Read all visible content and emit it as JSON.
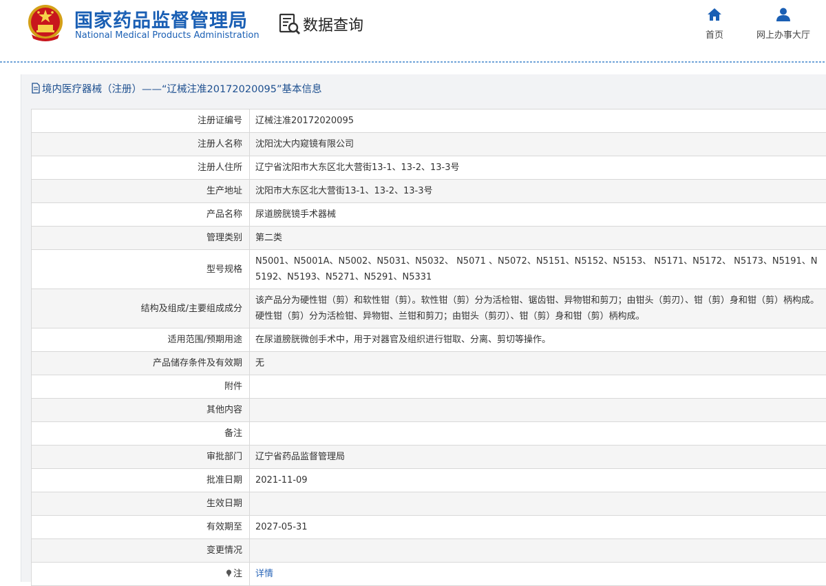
{
  "header": {
    "org_name_cn": "国家药品监督管理局",
    "org_name_en": "National Medical Products Administration",
    "query_label": "数据查询",
    "nav": [
      {
        "label": "首页",
        "icon": "home-icon"
      },
      {
        "label": "网上办事大厅",
        "icon": "user-icon"
      }
    ]
  },
  "colors": {
    "brand_blue": "#1a5fb4",
    "link_blue": "#2a66b8",
    "title_blue": "#1d4f8f",
    "alt_row": "#f5f5f5"
  },
  "panel": {
    "title": "境内医疗器械（注册）——“辽械注准20172020095”基本信息"
  },
  "rows": [
    {
      "label": "注册证编号",
      "value": "辽械注准20172020095"
    },
    {
      "label": "注册人名称",
      "value": "沈阳沈大内窥镜有限公司"
    },
    {
      "label": "注册人住所",
      "value": "辽宁省沈阳市大东区北大营街13-1、13-2、13-3号"
    },
    {
      "label": "生产地址",
      "value": "沈阳市大东区北大营街13-1、13-2、13-3号"
    },
    {
      "label": "产品名称",
      "value": "尿道膀胱镜手术器械"
    },
    {
      "label": "管理类别",
      "value": "第二类"
    },
    {
      "label": "型号规格",
      "value": "N5001、N5001A、N5002、N5031、N5032、 N5071 、N5072、N5151、N5152、N5153、 N5171、N5172、 N5173、N5191、N5192、N5193、N5271、N5291、N5331"
    },
    {
      "label": "结构及组成/主要组成成分",
      "value": "该产品分为硬性钳（剪）和软性钳（剪）。软性钳（剪）分为活检钳、锯齿钳、异物钳和剪刀；由钳头（剪刃）、钳（剪）身和钳（剪）柄构成。硬性钳（剪）分为活检钳、异物钳、兰钳和剪刀；由钳头（剪刃）、钳（剪）身和钳（剪）柄构成。"
    },
    {
      "label": "适用范围/预期用途",
      "value": "在尿道膀胱微创手术中，用于对器官及组织进行钳取、分离、剪切等操作。"
    },
    {
      "label": "产品储存条件及有效期",
      "value": "无"
    },
    {
      "label": "附件",
      "value": ""
    },
    {
      "label": "其他内容",
      "value": ""
    },
    {
      "label": "备注",
      "value": ""
    },
    {
      "label": "审批部门",
      "value": "辽宁省药品监督管理局"
    },
    {
      "label": "批准日期",
      "value": "2021-11-09"
    },
    {
      "label": "生效日期",
      "value": ""
    },
    {
      "label": "有效期至",
      "value": "2027-05-31"
    },
    {
      "label": "变更情况",
      "value": ""
    }
  ],
  "note_row": {
    "label": "注",
    "icon": "pin-icon",
    "link_text": "详情"
  }
}
